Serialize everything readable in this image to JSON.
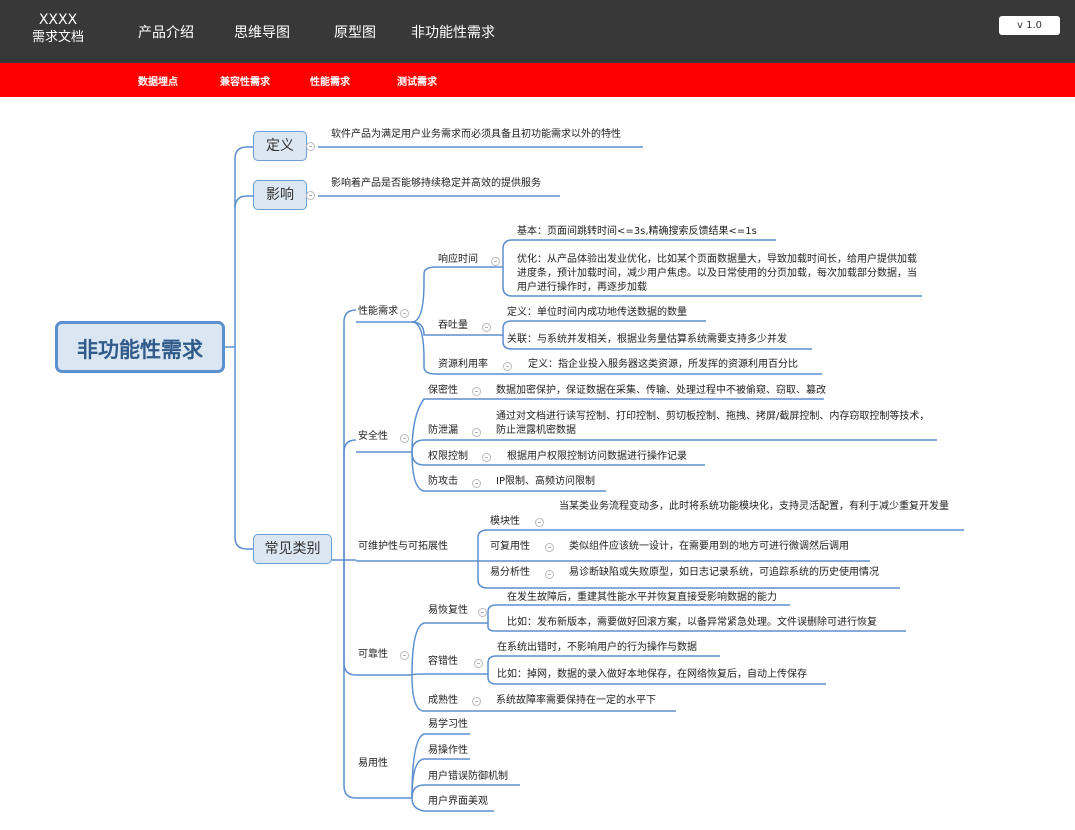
{
  "header": {
    "logo_line1": "XXXX",
    "logo_line2": "需求文档",
    "nav": [
      "产品介绍",
      "思维导图",
      "原型图",
      "非功能性需求"
    ],
    "version": "v 1.0"
  },
  "subnav": [
    "数据埋点",
    "兼容性需求",
    "性能需求",
    "测试需求"
  ],
  "colors": {
    "header_bg": "#383838",
    "subnav_bg": "#ff0000",
    "line": "#5b8fce",
    "node_fill": "#dbe6f3"
  },
  "mindmap": {
    "root": "非功能性需求",
    "definition": {
      "label": "定义",
      "text": "软件产品为满足用户业务需求而必须具备且初功能需求以外的特性"
    },
    "impact": {
      "label": "影响",
      "text": "影响着产品是否能够持续稳定并高效的提供服务"
    },
    "categories": {
      "label": "常见类别",
      "performance": {
        "label": "性能需求",
        "response": {
          "label": "响应时间",
          "basic": "基本：页面间跳转时间<=3s,精确搜索反馈结果<=1s",
          "opt": "优化：从产品体验出发业优化，比如某个页面数据量大，导致加载时间长，给用户提供加载进度条，预计加载时间，减少用户焦虑。以及日常使用的分页加载，每次加载部分数据，当用户进行操作时，再逐步加载"
        },
        "throughput": {
          "label": "吞吐量",
          "def": "定义：单位时间内成功地传送数据的数量",
          "rel": "关联：与系统并发相关，根据业务量估算系统需要支持多少并发"
        },
        "resource": {
          "label": "资源利用率",
          "def": "定义：指企业投入服务器这类资源，所发挥的资源利用百分比"
        }
      },
      "security": {
        "label": "安全性",
        "items": [
          {
            "label": "保密性",
            "text": "数据加密保护，保证数据在采集、传输、处理过程中不被偷窥、窃取、篡改"
          },
          {
            "label": "防泄漏",
            "text": "通过对文档进行读写控制、打印控制、剪切板控制、拖拽、拷屏/截屏控制、内存窃取控制等技术，防止泄露机密数据"
          },
          {
            "label": "权限控制",
            "text": "根据用户权限控制访问数据进行操作记录"
          },
          {
            "label": "防攻击",
            "text": "IP限制、高频访问限制"
          }
        ]
      },
      "maintainability": {
        "label": "可维护性与可拓展性",
        "items": [
          {
            "label": "模块性",
            "text": "当某类业务流程变动多，此时将系统功能模块化，支持灵活配置，有利于减少重复开发量"
          },
          {
            "label": "可复用性",
            "text": "类似组件应该统一设计，在需要用到的地方可进行微调然后调用"
          },
          {
            "label": "易分析性",
            "text": "易诊断缺陷或失败原型，如日志记录系统，可追踪系统的历史使用情况"
          }
        ]
      },
      "reliability": {
        "label": "可靠性",
        "recovery": {
          "label": "易恢复性",
          "a": "在发生故障后，重建其性能水平并恢复直接受影响数据的能力",
          "b": "比如：发布新版本，需要做好回滚方案，以备异常紧急处理。文件误删除可进行恢复"
        },
        "fault": {
          "label": "容错性",
          "a": "在系统出错时，不影响用户的行为操作与数据",
          "b": "比如：掉网，数据的录入做好本地保存，在网络恢复后，自动上传保存"
        },
        "maturity": {
          "label": "成熟性",
          "text": "系统故障率需要保持在一定的水平下"
        }
      },
      "usability": {
        "label": "易用性",
        "items": [
          "易学习性",
          "易操作性",
          "用户错误防御机制",
          "用户界面美观"
        ]
      }
    }
  }
}
